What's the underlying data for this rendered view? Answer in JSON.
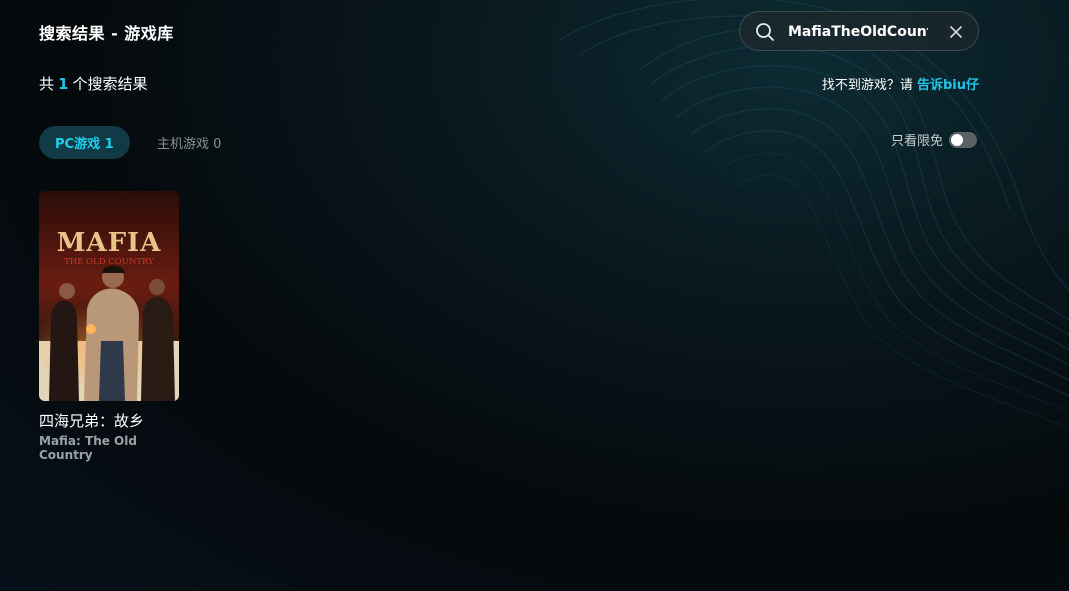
{
  "page": {
    "title": "搜索结果 - 游戏库"
  },
  "search": {
    "value": "MafiaTheOldCountr"
  },
  "results": {
    "prefix": "共",
    "count": "1",
    "suffix": "个搜索结果"
  },
  "feedback": {
    "text": "找不到游戏？请 ",
    "link": "告诉biu仔"
  },
  "tabs": [
    {
      "label": "PC游戏 1",
      "active": true
    },
    {
      "label": "主机游戏 0",
      "active": false
    }
  ],
  "filter": {
    "label": "只看限免",
    "enabled": false
  },
  "games": [
    {
      "title_cn": "四海兄弟：故乡",
      "title_en": "Mafia: The Old Country",
      "cover_title": "MAFIA",
      "cover_subtitle": "THE OLD COUNTRY"
    }
  ],
  "colors": {
    "accent": "#1fc7e6",
    "tab_active_bg": "#123a46"
  },
  "icons": {
    "search": "search-icon",
    "clear": "close-icon"
  }
}
